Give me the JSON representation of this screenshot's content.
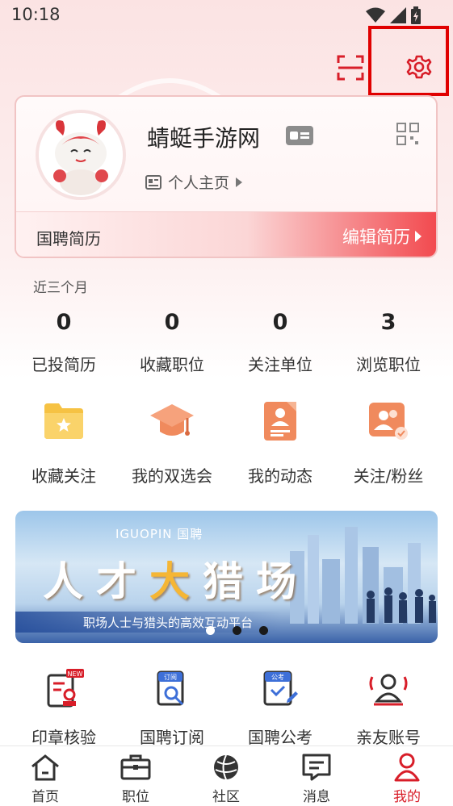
{
  "status_bar": {
    "time": "10:18"
  },
  "profile": {
    "nickname": "蜻蜓手游网",
    "homepage_label": "个人主页",
    "resume_label": "国聘简历",
    "edit_resume_label": "编辑简历"
  },
  "stats": {
    "period": "近三个月",
    "items": [
      {
        "value": "0",
        "label": "已投简历"
      },
      {
        "value": "0",
        "label": "收藏职位"
      },
      {
        "value": "0",
        "label": "关注单位"
      },
      {
        "value": "3",
        "label": "浏览职位"
      }
    ]
  },
  "quick_actions": [
    {
      "label": "收藏关注",
      "icon": "folder-star-icon"
    },
    {
      "label": "我的双选会",
      "icon": "graduation-cap-icon"
    },
    {
      "label": "我的动态",
      "icon": "person-doc-icon"
    },
    {
      "label": "关注/粉丝",
      "icon": "followers-icon"
    }
  ],
  "banner": {
    "brand": "IGUOPIN 国聘",
    "title_part1": "人才",
    "title_accent": "大",
    "title_part2": "猎场",
    "subtitle": "职场人士与猎头的高效互动平台",
    "slides": 3,
    "active_slide": 0
  },
  "tools": [
    {
      "label": "印章核验",
      "icon": "seal-verify-icon",
      "badge": "NEW"
    },
    {
      "label": "国聘订阅",
      "icon": "subscribe-icon",
      "badge_text": "订阅"
    },
    {
      "label": "国聘公考",
      "icon": "exam-icon",
      "badge_text": "公考"
    },
    {
      "label": "亲友账号",
      "icon": "family-account-icon"
    }
  ],
  "tabs": [
    {
      "label": "首页",
      "icon": "home-icon"
    },
    {
      "label": "职位",
      "icon": "briefcase-icon"
    },
    {
      "label": "社区",
      "icon": "globe-icon"
    },
    {
      "label": "消息",
      "icon": "message-icon"
    },
    {
      "label": "我的",
      "icon": "user-icon",
      "active": true
    }
  ],
  "colors": {
    "brand_red": "#d81e29",
    "highlight_red": "#e00000",
    "icon_orange": "#f08a5d",
    "icon_yellow": "#f7c744"
  }
}
